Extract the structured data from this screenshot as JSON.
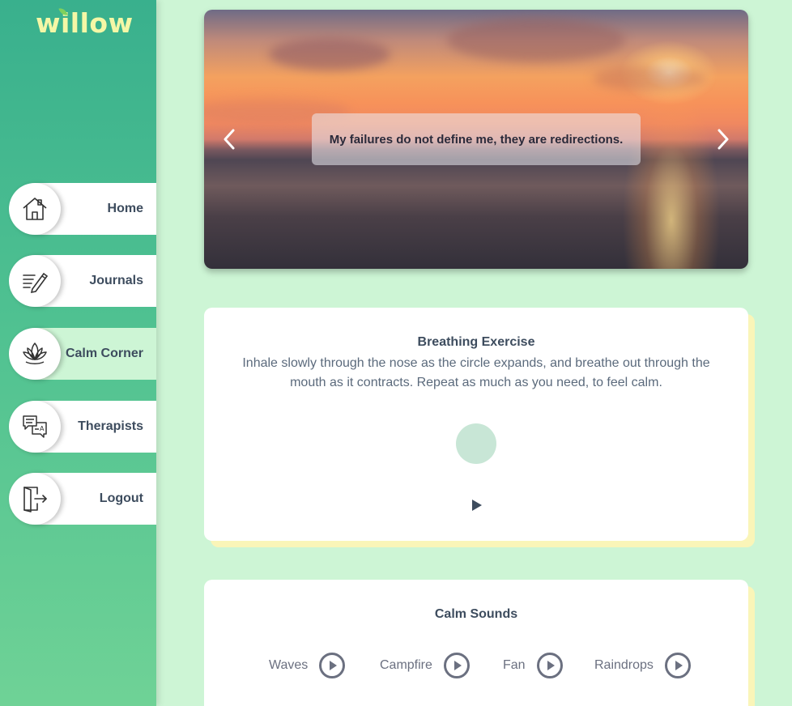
{
  "app": {
    "logo": "willow"
  },
  "sidebar": {
    "items": [
      {
        "label": "Home",
        "icon": "home-icon"
      },
      {
        "label": "Journals",
        "icon": "journal-pen-icon"
      },
      {
        "label": "Calm Corner",
        "icon": "lotus-icon",
        "active": true
      },
      {
        "label": "Therapists",
        "icon": "chat-bubbles-icon"
      },
      {
        "label": "Logout",
        "icon": "logout-door-icon"
      }
    ]
  },
  "hero": {
    "quote": "My failures do not define me, they are redirections.",
    "prev_icon": "chevron-left-icon",
    "next_icon": "chevron-right-icon"
  },
  "breathing": {
    "title": "Breathing Exercise",
    "description": "Inhale slowly through the nose as the circle expands, and breathe out through the mouth as it contracts. Repeat as much as you need, to feel calm.",
    "play_icon": "play-icon"
  },
  "sounds": {
    "title": "Calm Sounds",
    "items": [
      {
        "label": "Waves"
      },
      {
        "label": "Campfire"
      },
      {
        "label": "Fan"
      },
      {
        "label": "Raindrops"
      }
    ]
  },
  "colors": {
    "background": "#cdf5d5",
    "sidebar_top": "#39b08d",
    "sidebar_bottom": "#6fd296",
    "logo": "#f4f7a6",
    "card_shadow": "#faf5b8",
    "text_dark": "#3d4c5e"
  }
}
